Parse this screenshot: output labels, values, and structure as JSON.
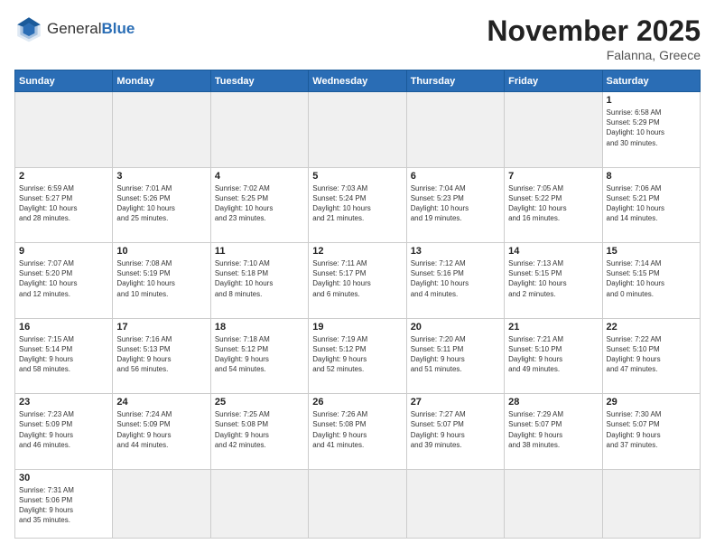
{
  "header": {
    "logo_general": "General",
    "logo_blue": "Blue",
    "month": "November 2025",
    "location": "Falanna, Greece"
  },
  "weekdays": [
    "Sunday",
    "Monday",
    "Tuesday",
    "Wednesday",
    "Thursday",
    "Friday",
    "Saturday"
  ],
  "days": [
    {
      "num": "",
      "info": "",
      "empty": true
    },
    {
      "num": "",
      "info": "",
      "empty": true
    },
    {
      "num": "",
      "info": "",
      "empty": true
    },
    {
      "num": "",
      "info": "",
      "empty": true
    },
    {
      "num": "",
      "info": "",
      "empty": true
    },
    {
      "num": "",
      "info": "",
      "empty": true
    },
    {
      "num": "1",
      "info": "Sunrise: 6:58 AM\nSunset: 5:29 PM\nDaylight: 10 hours\nand 30 minutes."
    },
    {
      "num": "2",
      "info": "Sunrise: 6:59 AM\nSunset: 5:27 PM\nDaylight: 10 hours\nand 28 minutes."
    },
    {
      "num": "3",
      "info": "Sunrise: 7:01 AM\nSunset: 5:26 PM\nDaylight: 10 hours\nand 25 minutes."
    },
    {
      "num": "4",
      "info": "Sunrise: 7:02 AM\nSunset: 5:25 PM\nDaylight: 10 hours\nand 23 minutes."
    },
    {
      "num": "5",
      "info": "Sunrise: 7:03 AM\nSunset: 5:24 PM\nDaylight: 10 hours\nand 21 minutes."
    },
    {
      "num": "6",
      "info": "Sunrise: 7:04 AM\nSunset: 5:23 PM\nDaylight: 10 hours\nand 19 minutes."
    },
    {
      "num": "7",
      "info": "Sunrise: 7:05 AM\nSunset: 5:22 PM\nDaylight: 10 hours\nand 16 minutes."
    },
    {
      "num": "8",
      "info": "Sunrise: 7:06 AM\nSunset: 5:21 PM\nDaylight: 10 hours\nand 14 minutes."
    },
    {
      "num": "9",
      "info": "Sunrise: 7:07 AM\nSunset: 5:20 PM\nDaylight: 10 hours\nand 12 minutes."
    },
    {
      "num": "10",
      "info": "Sunrise: 7:08 AM\nSunset: 5:19 PM\nDaylight: 10 hours\nand 10 minutes."
    },
    {
      "num": "11",
      "info": "Sunrise: 7:10 AM\nSunset: 5:18 PM\nDaylight: 10 hours\nand 8 minutes."
    },
    {
      "num": "12",
      "info": "Sunrise: 7:11 AM\nSunset: 5:17 PM\nDaylight: 10 hours\nand 6 minutes."
    },
    {
      "num": "13",
      "info": "Sunrise: 7:12 AM\nSunset: 5:16 PM\nDaylight: 10 hours\nand 4 minutes."
    },
    {
      "num": "14",
      "info": "Sunrise: 7:13 AM\nSunset: 5:15 PM\nDaylight: 10 hours\nand 2 minutes."
    },
    {
      "num": "15",
      "info": "Sunrise: 7:14 AM\nSunset: 5:15 PM\nDaylight: 10 hours\nand 0 minutes."
    },
    {
      "num": "16",
      "info": "Sunrise: 7:15 AM\nSunset: 5:14 PM\nDaylight: 9 hours\nand 58 minutes."
    },
    {
      "num": "17",
      "info": "Sunrise: 7:16 AM\nSunset: 5:13 PM\nDaylight: 9 hours\nand 56 minutes."
    },
    {
      "num": "18",
      "info": "Sunrise: 7:18 AM\nSunset: 5:12 PM\nDaylight: 9 hours\nand 54 minutes."
    },
    {
      "num": "19",
      "info": "Sunrise: 7:19 AM\nSunset: 5:12 PM\nDaylight: 9 hours\nand 52 minutes."
    },
    {
      "num": "20",
      "info": "Sunrise: 7:20 AM\nSunset: 5:11 PM\nDaylight: 9 hours\nand 51 minutes."
    },
    {
      "num": "21",
      "info": "Sunrise: 7:21 AM\nSunset: 5:10 PM\nDaylight: 9 hours\nand 49 minutes."
    },
    {
      "num": "22",
      "info": "Sunrise: 7:22 AM\nSunset: 5:10 PM\nDaylight: 9 hours\nand 47 minutes."
    },
    {
      "num": "23",
      "info": "Sunrise: 7:23 AM\nSunset: 5:09 PM\nDaylight: 9 hours\nand 46 minutes."
    },
    {
      "num": "24",
      "info": "Sunrise: 7:24 AM\nSunset: 5:09 PM\nDaylight: 9 hours\nand 44 minutes."
    },
    {
      "num": "25",
      "info": "Sunrise: 7:25 AM\nSunset: 5:08 PM\nDaylight: 9 hours\nand 42 minutes."
    },
    {
      "num": "26",
      "info": "Sunrise: 7:26 AM\nSunset: 5:08 PM\nDaylight: 9 hours\nand 41 minutes."
    },
    {
      "num": "27",
      "info": "Sunrise: 7:27 AM\nSunset: 5:07 PM\nDaylight: 9 hours\nand 39 minutes."
    },
    {
      "num": "28",
      "info": "Sunrise: 7:29 AM\nSunset: 5:07 PM\nDaylight: 9 hours\nand 38 minutes."
    },
    {
      "num": "29",
      "info": "Sunrise: 7:30 AM\nSunset: 5:07 PM\nDaylight: 9 hours\nand 37 minutes."
    },
    {
      "num": "30",
      "info": "Sunrise: 7:31 AM\nSunset: 5:06 PM\nDaylight: 9 hours\nand 35 minutes."
    },
    {
      "num": "",
      "info": "",
      "empty": true
    },
    {
      "num": "",
      "info": "",
      "empty": true
    },
    {
      "num": "",
      "info": "",
      "empty": true
    },
    {
      "num": "",
      "info": "",
      "empty": true
    },
    {
      "num": "",
      "info": "",
      "empty": true
    },
    {
      "num": "",
      "info": "",
      "empty": true
    }
  ]
}
